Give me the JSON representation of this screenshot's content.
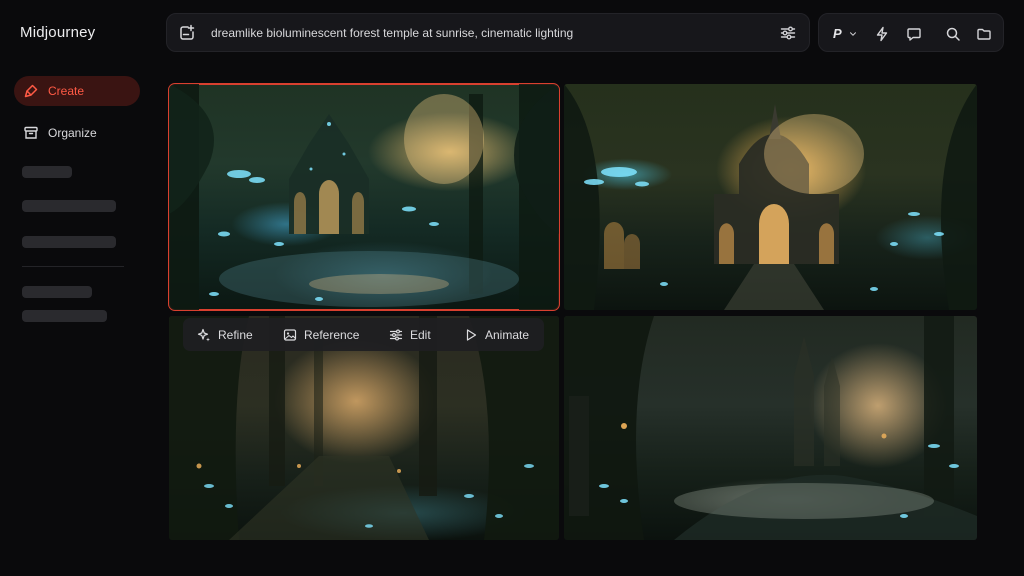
{
  "app": {
    "name": "Midjourney"
  },
  "sidebar": {
    "items": [
      {
        "label": "Create",
        "icon": "brush-icon",
        "active": true
      },
      {
        "label": "Organize",
        "icon": "archive-icon",
        "active": false
      }
    ]
  },
  "prompt": {
    "text": "dreamlike bioluminescent forest temple at sunrise, cinematic lighting"
  },
  "toolbar": {
    "profile_label": "P",
    "icons": [
      "chevron-down-icon",
      "lightning-icon",
      "chat-icon",
      "search-icon",
      "folder-icon"
    ]
  },
  "grid": {
    "images": [
      {
        "name": "image-1",
        "selected": true
      },
      {
        "name": "image-2",
        "selected": false
      },
      {
        "name": "image-3",
        "selected": false
      },
      {
        "name": "image-4",
        "selected": false
      }
    ]
  },
  "actions": [
    {
      "label": "Refine",
      "icon": "sparkle-icon"
    },
    {
      "label": "Reference",
      "icon": "image-icon"
    },
    {
      "label": "Edit",
      "icon": "sliders-icon"
    },
    {
      "label": "Animate",
      "icon": "play-icon"
    }
  ],
  "colors": {
    "accent": "#ff5a45",
    "accent_bg": "#3a1412",
    "selection_border": "#d9402f",
    "background": "#0a0a0c",
    "panel": "#17171b"
  }
}
